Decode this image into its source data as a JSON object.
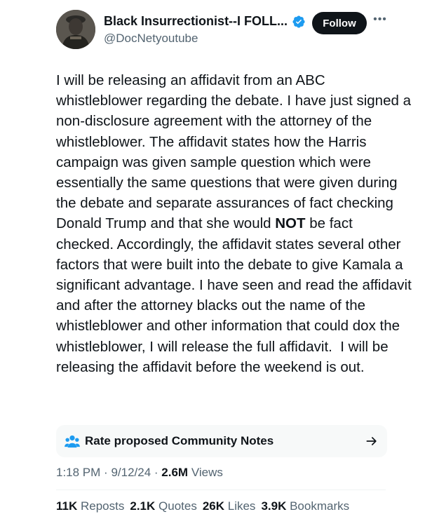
{
  "author": {
    "display_name": "Black Insurrectionist--I FOLL...",
    "handle": "@DocNetyoutube",
    "verified": true,
    "verified_color": "#1d9bf0"
  },
  "follow_label": "Follow",
  "more_icon": "more-horizontal-icon",
  "tweet": {
    "text_before_bold": "I will be releasing an affidavit from an ABC whistleblower regarding the debate. I have just signed a non-disclosure agreement with the attorney of the whistleblower. The affidavit states how the Harris campaign was given sample question which were essentially the same questions that were given during the debate and separate assurances of fact checking Donald Trump and that she would ",
    "bold_word": "NOT",
    "text_after_bold": " be fact checked. Accordingly, the affidavit states several other factors that were built into the debate to give Kamala a significant advantage. I have seen and read the affidavit and after the attorney blacks out the name of the whistleblower and other information that could dox the whistleblower, I will release the full affidavit.  I will be releasing the affidavit before the weekend is out."
  },
  "community_notes": {
    "label": "Rate proposed Community Notes",
    "icon": "community-notes-icon",
    "arrow_icon": "arrow-right-icon"
  },
  "meta": {
    "time": "1:18 PM",
    "date": "9/12/24",
    "views_count": "2.6M",
    "views_label": "Views"
  },
  "stats": {
    "reposts_count": "11K",
    "reposts_label": "Reposts",
    "quotes_count": "2.1K",
    "quotes_label": "Quotes",
    "likes_count": "26K",
    "likes_label": "Likes",
    "bookmarks_count": "3.9K",
    "bookmarks_label": "Bookmarks"
  }
}
